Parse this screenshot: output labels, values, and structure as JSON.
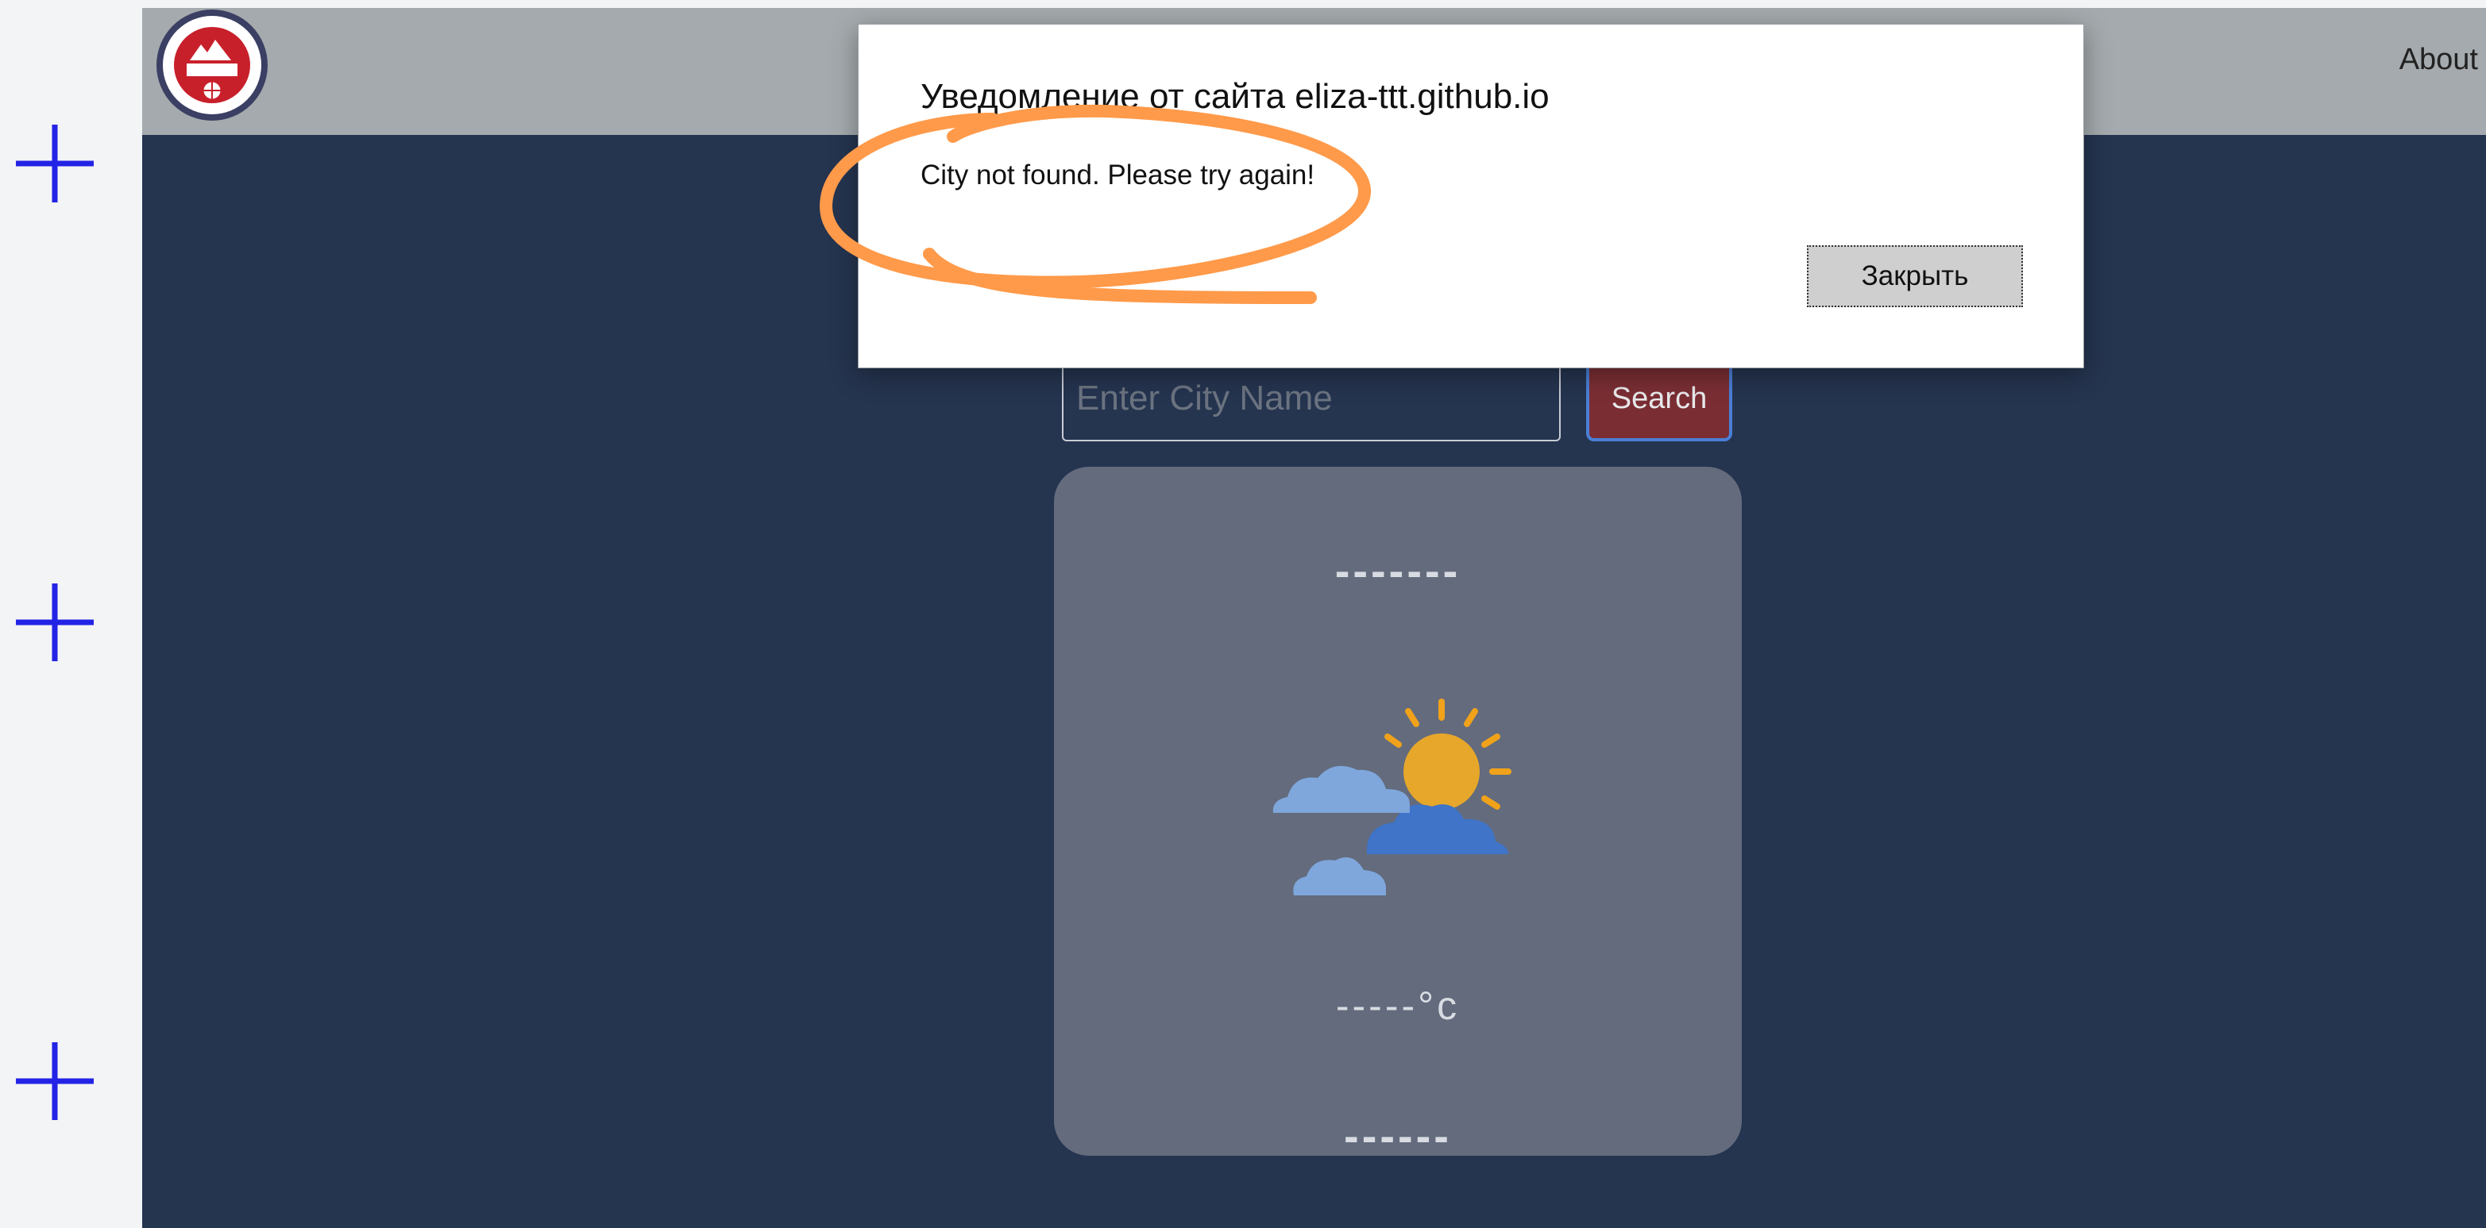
{
  "nav": {
    "about_label": "About"
  },
  "search": {
    "placeholder": "Enter City Name",
    "button_label": "Search"
  },
  "weather": {
    "city": "-------",
    "temperature": "-----°c",
    "description": "------"
  },
  "dialog": {
    "title": "Уведомление от сайта eliza-ttt.github.io",
    "message": "City not found. Please try again!",
    "close_label": "Закрыть"
  },
  "icons": {
    "logo": "university-seal-logo",
    "weather": "partly-cloudy-icon",
    "plus": "plus-icon"
  },
  "colors": {
    "header_bg": "#a4aaad",
    "page_bg": "#25344f",
    "card_bg": "#636b7d",
    "search_button_bg": "#7a2e34",
    "annotation": "#ff9a4a",
    "plus_marks": "#2323e6"
  }
}
